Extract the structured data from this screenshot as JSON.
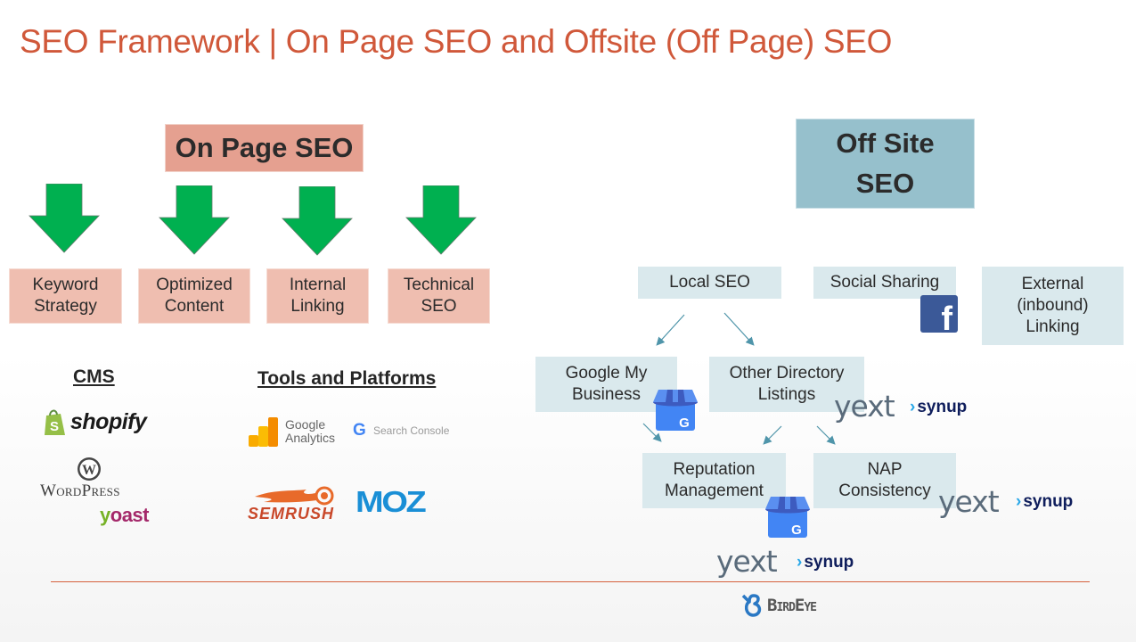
{
  "title": "SEO Framework | On Page SEO and Offsite (Off Page) SEO",
  "colors": {
    "title": "#d0583a",
    "on_page_header_bg": "#e5a090",
    "on_page_item_bg": "#efbeb0",
    "arrow_green": "#00b050",
    "off_site_header_bg": "#96c0cc",
    "off_site_item_bg": "#dae9ed",
    "connector": "#4f95aa",
    "divider": "#d5603e"
  },
  "on_page": {
    "header": "On Page SEO",
    "items": [
      {
        "label": "Keyword\nStrategy"
      },
      {
        "label": "Optimized\nContent"
      },
      {
        "label": "Internal\nLinking"
      },
      {
        "label": "Technical\nSEO"
      }
    ],
    "cms": {
      "heading": "CMS",
      "logos": [
        {
          "name": "shopify",
          "text": "shopify"
        },
        {
          "name": "wordpress",
          "text": "WordPress"
        },
        {
          "name": "yoast",
          "text": "yoast"
        }
      ]
    },
    "tools": {
      "heading": "Tools and Platforms",
      "logos": [
        {
          "name": "google-analytics",
          "line1": "Google",
          "line2": "Analytics"
        },
        {
          "name": "search-console",
          "text": "Search Console"
        },
        {
          "name": "semrush",
          "text": "SEMRUSH"
        },
        {
          "name": "moz",
          "text": "MOZ"
        }
      ]
    }
  },
  "off_site": {
    "header": "Off Site\nSEO",
    "items": {
      "local_seo": "Local SEO",
      "social_sharing": "Social Sharing",
      "external_linking": "External\n(inbound)\nLinking",
      "google_my_business": "Google My\nBusiness",
      "other_directory": "Other Directory\nListings",
      "reputation": "Reputation\nManagement",
      "nap": "NAP\nConsistency"
    },
    "logos": {
      "yext": "yext",
      "synup": "synup",
      "birdeye": "BirdEye",
      "facebook": "f",
      "gmb_g": "G"
    }
  }
}
